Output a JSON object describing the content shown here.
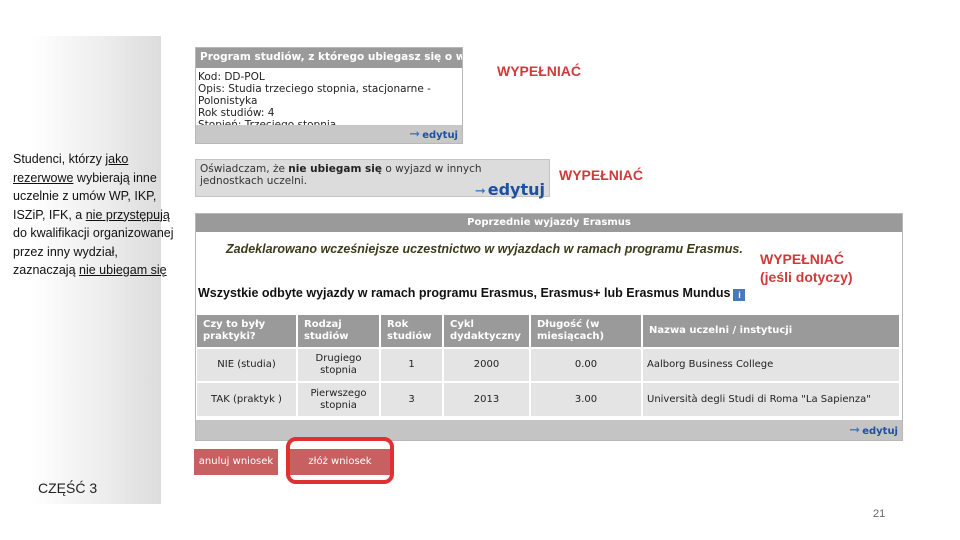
{
  "sidebar_text": {
    "l1": "Studenci, którzy ",
    "l1u": "jako",
    "l2u": "rezerwowe",
    "l2": " wybierają inne",
    "l3": "uczelnie z umów WP, IKP,",
    "l4a": "ISZiP, IFK, a ",
    "l4u": "nie przystępują",
    "l5": "do kwalifikacji organizowanej",
    "l6": "przez inny wydział,",
    "l7a": "zaznaczają ",
    "l7u": "nie ubiegam się"
  },
  "part_label": "CZĘŚĆ 3",
  "page_number": "21",
  "fill_labels": {
    "a": "WYPEŁNIAĆ",
    "b": "WYPEŁNIAĆ",
    "c1": "WYPEŁNIAĆ",
    "c2": "(jeśli dotyczy)"
  },
  "program_box": {
    "header": "Program studiów, z którego ubiegasz się o wyjazd",
    "lines": [
      "Kod: DD-POL",
      "Opis: Studia trzeciego stopnia, stacjonarne - Polonistyka",
      "Rok studiów: 4",
      "Stopień: Trzeciego stopnia"
    ],
    "edit": "edytuj"
  },
  "declaration_box": {
    "pre": "Oświadczam, że ",
    "bold": "nie ubiegam się",
    "post": " o wyjazd w innych jednostkach uczelni.",
    "edit": "edytuj"
  },
  "erasmus_box": {
    "header": "Poprzednie wyjazdy Erasmus",
    "declared": "Zadeklarowano wcześniejsze uczestnictwo w wyjazdach w ramach programu Erasmus.",
    "all_trips": "Wszystkie odbyte wyjazdy w ramach programu Erasmus, Erasmus+ lub Erasmus Mundus",
    "info_icon": "info-icon",
    "columns": [
      "Czy to były praktyki?",
      "Rodzaj studiów",
      "Rok studiów",
      "Cykl dydaktyczny",
      "Długość (w miesiącach)",
      "Nazwa uczelni / instytucji"
    ],
    "rows": [
      [
        "NIE (studia)",
        "Drugiego stopnia",
        "1",
        "2000",
        "0.00",
        "Aalborg Business College"
      ],
      [
        "TAK (praktyk )",
        "Pierwszego stopnia",
        "3",
        "2013",
        "3.00",
        "Università degli Studi di Roma \"La Sapienza\""
      ]
    ],
    "edit": "edytuj"
  },
  "buttons": {
    "cancel": "anuluj wniosek",
    "submit": "złóż wniosek"
  },
  "colors": {
    "highlight": "#e03030",
    "fill_label": "#d03a3a",
    "button": "#c76060"
  }
}
